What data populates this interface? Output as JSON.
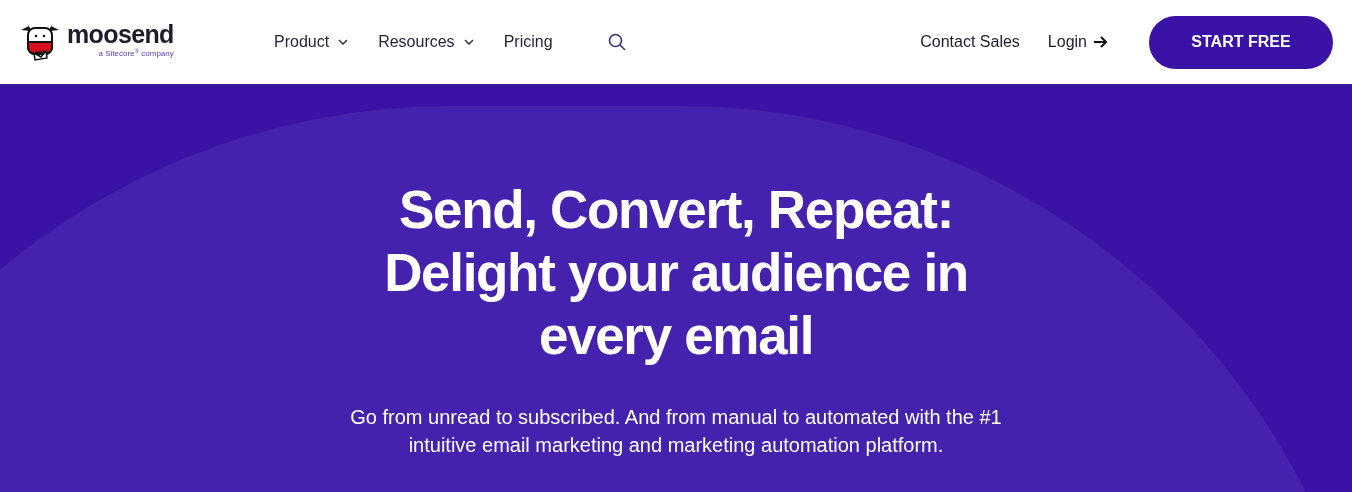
{
  "header": {
    "logo": {
      "name": "moosend",
      "tagline": "a Sitecore$^{®}$ company"
    },
    "nav": [
      {
        "label": "Product",
        "dropdown": true
      },
      {
        "label": "Resources",
        "dropdown": true
      },
      {
        "label": "Pricing",
        "dropdown": false
      }
    ],
    "contact": "Contact Sales",
    "login": "Login",
    "cta": "START FREE"
  },
  "hero": {
    "headline": [
      "Send, Convert, Repeat:",
      "Delight your audience in",
      "every email"
    ],
    "subtitle": "Go from unread to subscribed. And from manual to automated with the #1 intuitive email marketing and marketing automation platform."
  }
}
